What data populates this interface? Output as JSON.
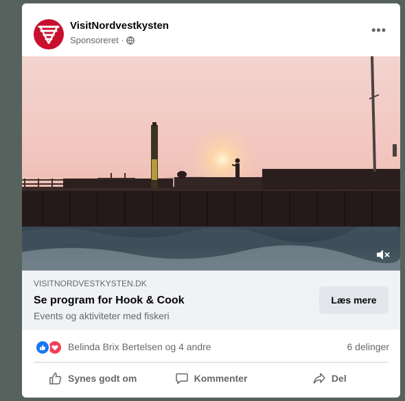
{
  "post": {
    "page_name": "VisitNordvestkysten",
    "sponsored_label": "Sponsoreret · ",
    "more_label": "•••"
  },
  "link_preview": {
    "domain": "VISITNORDVESTKYSTEN.DK",
    "headline": "Se program for Hook & Cook",
    "description": "Events og aktiviteter med fiskeri",
    "cta_label": "Læs mere"
  },
  "engagement": {
    "reaction_names": "Belinda Brix Bertelsen og 4 andre",
    "shares": "6 delinger"
  },
  "actions": {
    "like": "Synes godt om",
    "comment": "Kommenter",
    "share": "Del"
  },
  "colors": {
    "brand": "#c8102e",
    "like_blue": "#1877f2",
    "love_red": "#f33e58",
    "background": "#56625e"
  },
  "icons": {
    "globe": "globe-icon",
    "mute": "volume-muted-icon",
    "like": "thumbs-up-icon",
    "comment": "comment-icon",
    "share": "share-arrow-icon"
  }
}
